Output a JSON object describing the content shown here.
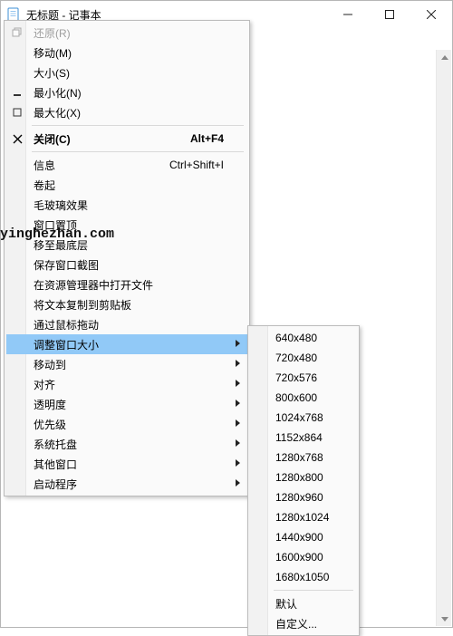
{
  "window": {
    "title": "无标题 - 记事本"
  },
  "menu": {
    "items": [
      {
        "label": "还原(R)"
      },
      {
        "label": "移动(M)"
      },
      {
        "label": "大小(S)"
      },
      {
        "label": "最小化(N)"
      },
      {
        "label": "最大化(X)"
      },
      {
        "label": "关闭(C)",
        "accel": "Alt+F4"
      },
      {
        "label": "信息",
        "accel": "Ctrl+Shift+I"
      },
      {
        "label": "卷起"
      },
      {
        "label": "毛玻璃效果"
      },
      {
        "label": "窗口置顶"
      },
      {
        "label": "移至最底层"
      },
      {
        "label": "保存窗口截图"
      },
      {
        "label": "在资源管理器中打开文件"
      },
      {
        "label": "将文本复制到剪贴板"
      },
      {
        "label": "通过鼠标拖动"
      },
      {
        "label": "调整窗口大小"
      },
      {
        "label": "移动到"
      },
      {
        "label": "对齐"
      },
      {
        "label": "透明度"
      },
      {
        "label": "优先级"
      },
      {
        "label": "系统托盘"
      },
      {
        "label": "其他窗口"
      },
      {
        "label": "启动程序"
      }
    ]
  },
  "submenu": {
    "items": [
      {
        "label": "640x480"
      },
      {
        "label": "720x480"
      },
      {
        "label": "720x576"
      },
      {
        "label": "800x600"
      },
      {
        "label": "1024x768"
      },
      {
        "label": "1152x864"
      },
      {
        "label": "1280x768"
      },
      {
        "label": "1280x800"
      },
      {
        "label": "1280x960"
      },
      {
        "label": "1280x1024"
      },
      {
        "label": "1440x900"
      },
      {
        "label": "1600x900"
      },
      {
        "label": "1680x1050"
      },
      {
        "label": "默认"
      },
      {
        "label": "自定义..."
      }
    ]
  },
  "watermark": "yinghezhan.com"
}
